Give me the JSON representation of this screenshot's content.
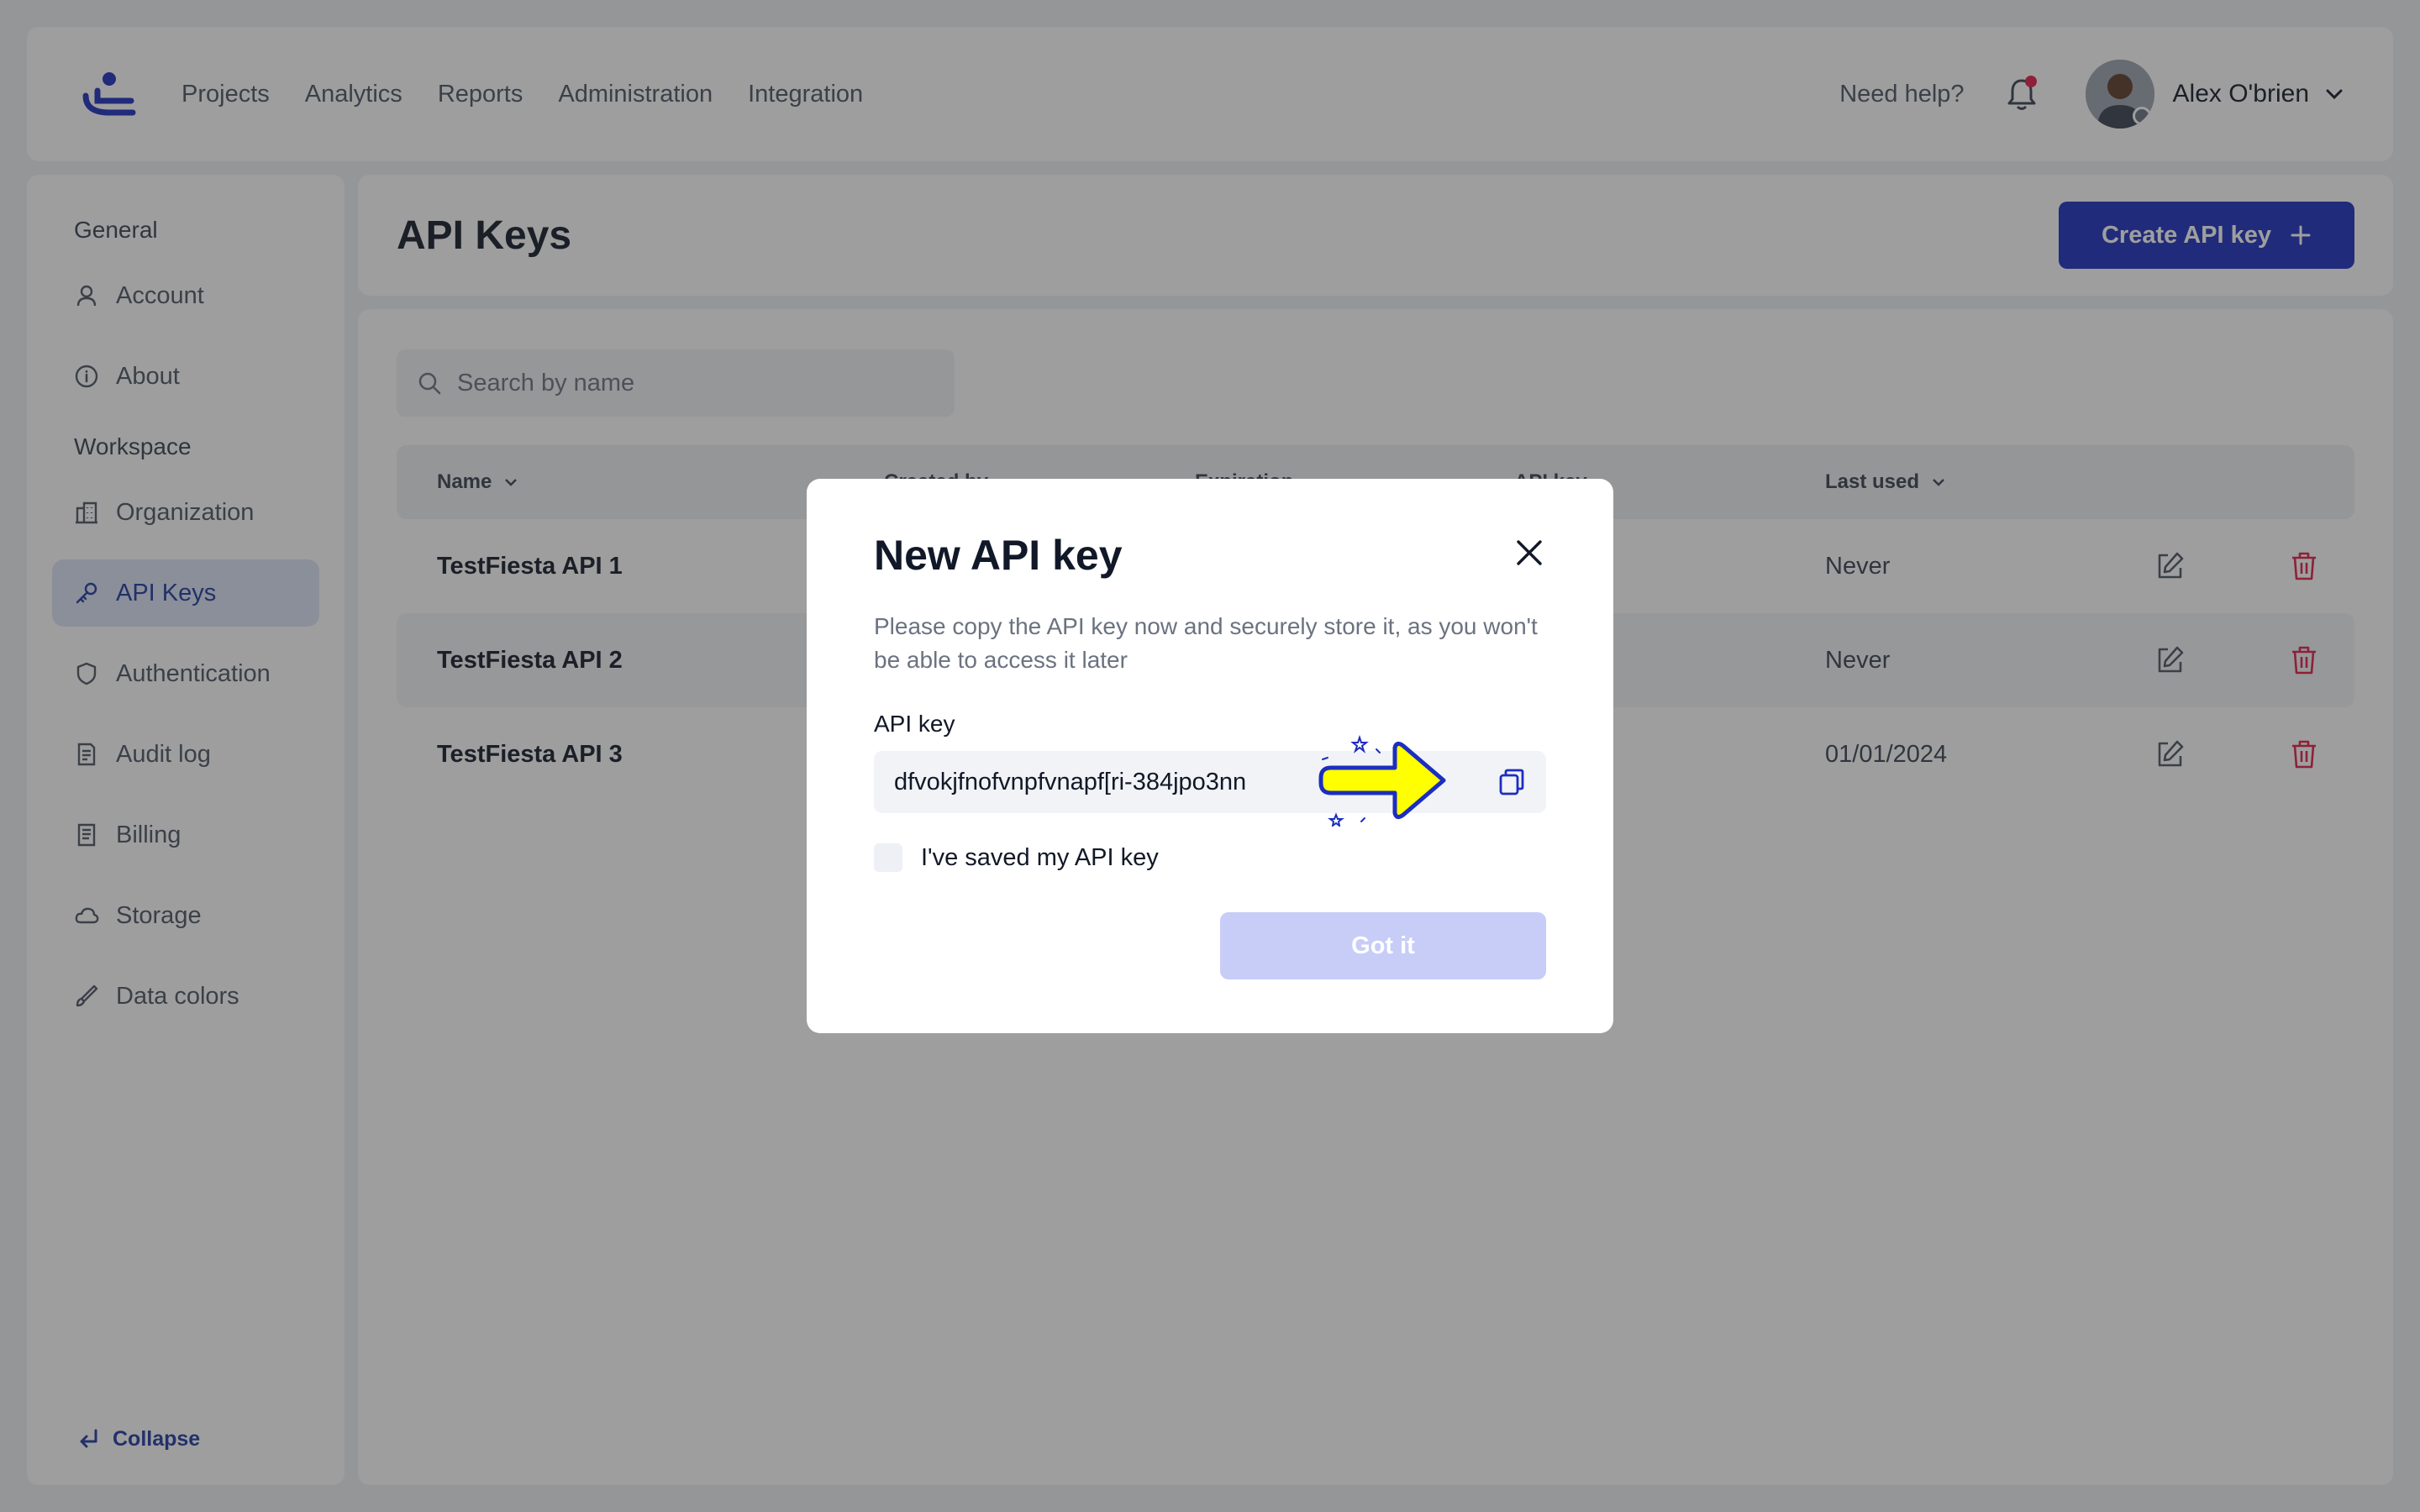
{
  "nav": {
    "items": [
      "Projects",
      "Analytics",
      "Reports",
      "Administration",
      "Integration"
    ],
    "help": "Need help?",
    "user_name": "Alex O'brien"
  },
  "sidebar": {
    "general_title": "General",
    "workspace_title": "Workspace",
    "general_items": [
      {
        "label": "Account",
        "icon": "user-icon"
      },
      {
        "label": "About",
        "icon": "info-icon"
      }
    ],
    "workspace_items": [
      {
        "label": "Organization",
        "icon": "building-icon"
      },
      {
        "label": "API Keys",
        "icon": "key-icon",
        "active": true
      },
      {
        "label": "Authentication",
        "icon": "shield-icon"
      },
      {
        "label": "Audit log",
        "icon": "document-icon"
      },
      {
        "label": "Billing",
        "icon": "receipt-icon"
      },
      {
        "label": "Storage",
        "icon": "cloud-icon"
      },
      {
        "label": "Data colors",
        "icon": "brush-icon"
      }
    ],
    "collapse": "Collapse"
  },
  "page": {
    "title": "API Keys",
    "create_button": "Create API key",
    "search_placeholder": "Search by name"
  },
  "table": {
    "headers": [
      "Name",
      "Created by",
      "Expiration",
      "API key",
      "Last used"
    ],
    "rows": [
      {
        "name": "TestFiesta API 1",
        "api_key": "**",
        "last_used": "Never"
      },
      {
        "name": "TestFiesta API 2",
        "api_key": "**",
        "last_used": "Never"
      },
      {
        "name": "TestFiesta API 3",
        "api_key": "*",
        "last_used": "01/01/2024"
      }
    ]
  },
  "modal": {
    "title": "New API key",
    "description": "Please copy the API key now and securely store it, as you won't be able to access it later",
    "field_label": "API key",
    "api_key_value": "dfvokjfnofvnpfvnapf[ri-384jpo3nn",
    "checkbox_label": "I've saved my API key",
    "confirm_button": "Got it"
  },
  "colors": {
    "primary": "#1c2ec0",
    "danger": "#e11d48",
    "highlight_arrow": "#ffff00"
  }
}
